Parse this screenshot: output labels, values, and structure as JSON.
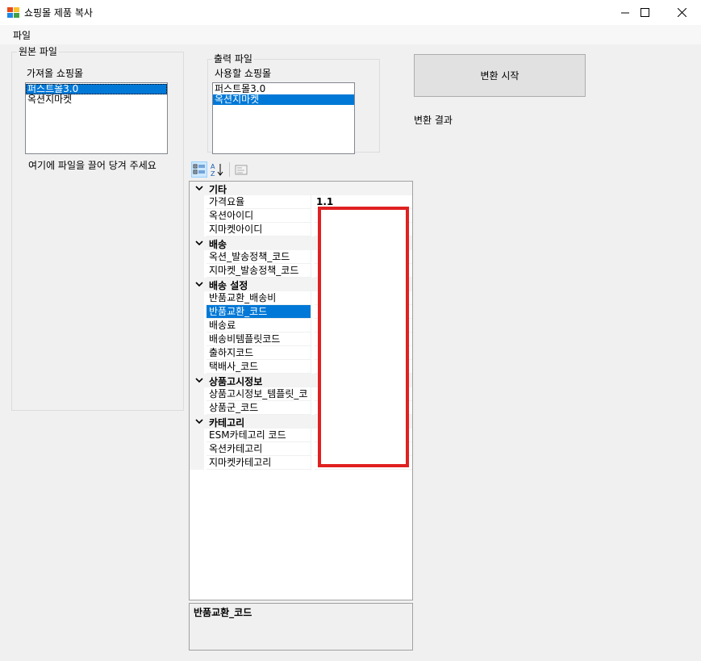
{
  "window": {
    "title": "쇼핑몰 제품 복사",
    "minimize_glyph": "—",
    "maximize_glyph": "☐",
    "close_glyph": "✕"
  },
  "menu": {
    "file": "파일"
  },
  "source": {
    "group_title": "원본 파일",
    "label": "가져올 쇼핑몰",
    "items": [
      "퍼스트몰3.0",
      "옥션지마켓"
    ],
    "drop_hint": "여기에 파일을 끌어 당겨 주세요"
  },
  "output": {
    "group_title": "출력 파일",
    "label": "사용할 쇼핑몰",
    "items": [
      "퍼스트몰3.0",
      "옥션지마켓"
    ]
  },
  "convert": {
    "button": "변환 시작",
    "result_label": "변환 결과"
  },
  "property_grid": {
    "categories": [
      {
        "name": "기타",
        "props": [
          {
            "name": "가격요율",
            "value": "1.1"
          },
          {
            "name": "옥션아이디",
            "value": ""
          },
          {
            "name": "지마켓아이디",
            "value": ""
          }
        ]
      },
      {
        "name": "배송",
        "props": [
          {
            "name": "옥션_발송정책_코드",
            "value": ""
          },
          {
            "name": "지마켓_발송정책_코드",
            "value": ""
          }
        ]
      },
      {
        "name": "배송 설정",
        "props": [
          {
            "name": "반품교환_배송비",
            "value": ""
          },
          {
            "name": "반품교환_코드",
            "value": ""
          },
          {
            "name": "배송료",
            "value": ""
          },
          {
            "name": "배송비템플릿코드",
            "value": ""
          },
          {
            "name": "출하지코드",
            "value": ""
          },
          {
            "name": "택배사_코드",
            "value": ""
          }
        ]
      },
      {
        "name": "상품고시정보",
        "props": [
          {
            "name": "상품고시정보_템플릿_코",
            "value": ""
          },
          {
            "name": "상품군_코드",
            "value": ""
          }
        ]
      },
      {
        "name": "카테고리",
        "props": [
          {
            "name": "ESM카테고리 코드",
            "value": ""
          },
          {
            "name": "옥션카테고리",
            "value": ""
          },
          {
            "name": "지마켓카테고리",
            "value": ""
          }
        ]
      }
    ],
    "help_title": "반품교환_코드"
  },
  "colors": {
    "selection": "#0078d7",
    "highlight_box": "#e02020"
  }
}
